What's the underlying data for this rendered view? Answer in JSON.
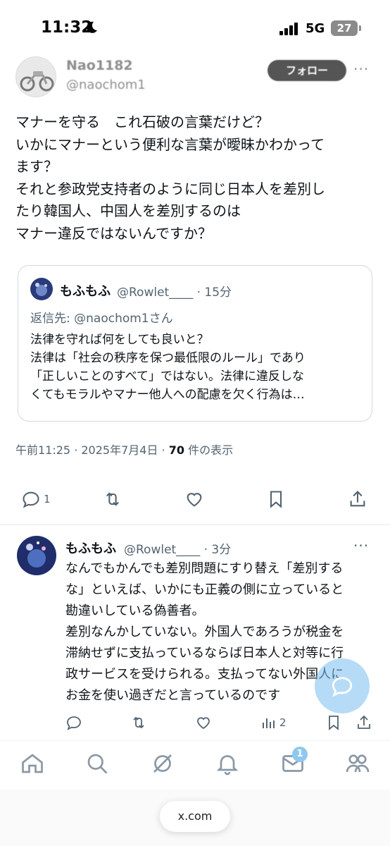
{
  "status_bar": {
    "time": "11:32",
    "network": "5G",
    "battery": "27"
  },
  "main_post": {
    "display_name": "Nao1182",
    "handle": "@naochom1",
    "follow_label": "フォロー",
    "more": "···",
    "body_lines": [
      "マナーを守る　これ石破の言葉だけど？",
      "いかにマナーという便利な言葉が曖昧かわかって",
      "ます？",
      "それと参政党支持者のように同じ日本人を差別し",
      "たり韓国人、中国人を差別するのは",
      "マナー違反ではないんですか？"
    ],
    "quote": {
      "name": "もふもふ",
      "meta": "@Rowlet____ · 15分",
      "reply_to": "返信先: @naochom1さん",
      "lines": [
        "法律を守れば何をしても良いと？",
        "法律は「社会の秩序を保つ最低限のルール」であり",
        "「正しいことのすべて」ではない。法律に違反しな",
        "くてもモラルやマナー他人への配慮を欠く行為は…"
      ]
    },
    "timestamp": "午前11:25 · 2025年7月4日 · ",
    "views_count": "70",
    "views_label": " 件の表示",
    "reply_count": "1"
  },
  "reply_post": {
    "name": "もふもふ",
    "meta": "@Rowlet____ · 3分",
    "more": "···",
    "lines": [
      "なんでもかんでも差別問題にすり替え「差別する",
      "な」といえば、いかにも正義の側に立っていると",
      "勘違いしている偽善者。",
      "差別なんかしていない。外国人であろうが税金を",
      "滞納せずに支払っているならば日本人と対等に行",
      "政サービスを受けられる。支払ってない外国人に",
      "お金を使い過ぎだと言っているのです"
    ],
    "views_count": "2"
  },
  "nav": {
    "notification_badge": "1"
  },
  "browser": {
    "url": "x.com"
  },
  "colors": {
    "accent": "#1d9bf0",
    "secondary_text": "#536471",
    "border": "#cfd9de"
  }
}
